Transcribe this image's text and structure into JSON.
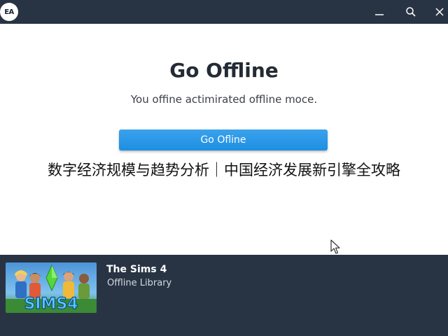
{
  "titlebar": {
    "logo_text": "EA",
    "controls": [
      "minimize-icon",
      "search-icon",
      "close-icon"
    ],
    "background": "#283444"
  },
  "dialog": {
    "title": "Go Offline",
    "description": "You offine actimirated offline moce.",
    "button_label": "Go Ofline",
    "button_color": "#2196e8"
  },
  "banner": {
    "text": "数字经济规模与趋势分析｜中国经济发展新引擎全攻略"
  },
  "footer": {
    "game_title": "The Sims 4",
    "game_subtitle": "Offline Library",
    "art_logo_text": "SIMS4"
  }
}
